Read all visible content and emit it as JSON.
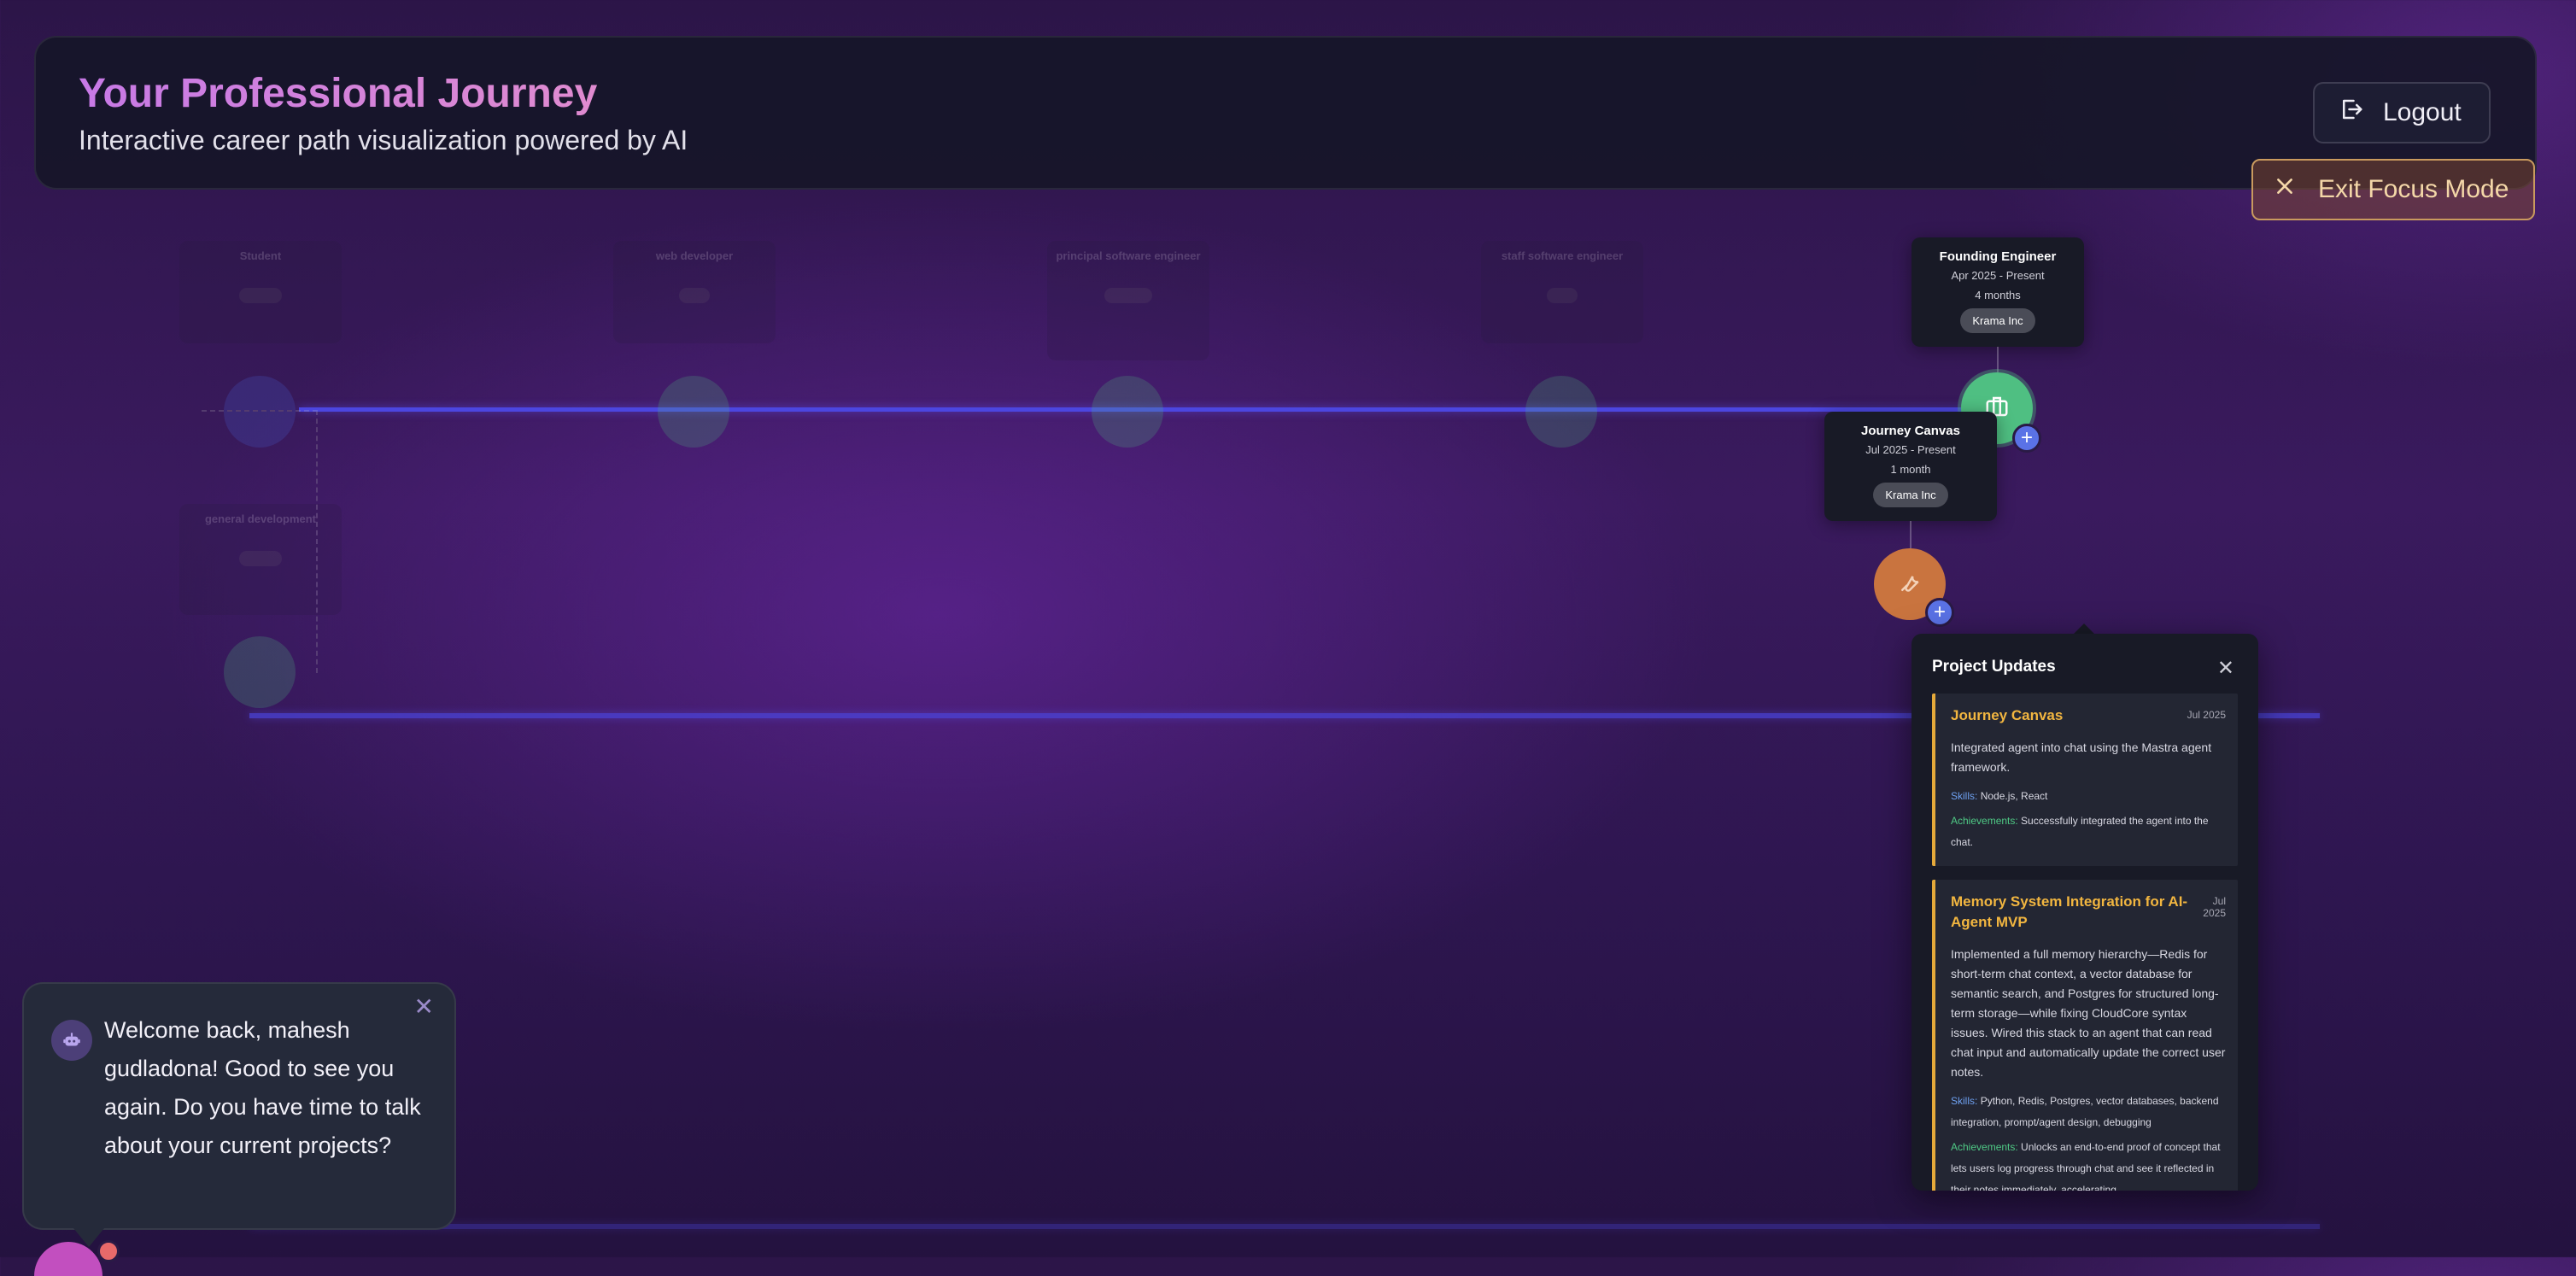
{
  "header": {
    "title": "Your Professional Journey",
    "subtitle": "Interactive career path visualization powered by AI",
    "logout_label": "Logout"
  },
  "exit_focus_label": "Exit Focus Mode",
  "faded_nodes": [
    {
      "title": "Student"
    },
    {
      "title": "web developer"
    },
    {
      "title": "principal software engineer"
    },
    {
      "title": "staff software engineer"
    },
    {
      "title": "general development"
    }
  ],
  "focused_role": {
    "title": "Founding Engineer",
    "dates": "Apr 2025 - Present",
    "duration": "4 months",
    "company": "Krama Inc"
  },
  "focused_project": {
    "title": "Journey Canvas",
    "dates": "Jul 2025 - Present",
    "duration": "1 month",
    "company": "Krama Inc"
  },
  "project_updates": {
    "title": "Project Updates",
    "items": [
      {
        "title": "Journey Canvas",
        "date": "Jul 2025",
        "description": "Integrated agent into chat using the Mastra agent framework.",
        "skills_label": "Skills:",
        "skills": "Node.js, React",
        "achievements_label": "Achievements:",
        "achievements": "Successfully integrated the agent into the chat."
      },
      {
        "title": "Memory System Integration for AI-Agent MVP",
        "date": "Jul 2025",
        "description": "Implemented a full memory hierarchy—Redis for short-term chat context, a vector database for semantic search, and Postgres for structured long-term storage—while fixing CloudCore syntax issues. Wired this stack to an agent that can read chat input and automatically update the correct user notes.",
        "skills_label": "Skills:",
        "skills": "Python, Redis, Postgres, vector databases, backend integration, prompt/agent design, debugging",
        "achievements_label": "Achievements:",
        "achievements": "Unlocks an end-to-end proof of concept that lets users log progress through chat and see it reflected in their notes immediately, accelerating"
      }
    ]
  },
  "chat": {
    "message": "Welcome back, mahesh gudladona! Good to see you again. Do you have time to talk about your current projects?"
  },
  "colors": {
    "accent": "#4c46e0",
    "role_node": "#4fbf82",
    "project_node": "#c9743f",
    "update_border": "#e5a93a"
  }
}
